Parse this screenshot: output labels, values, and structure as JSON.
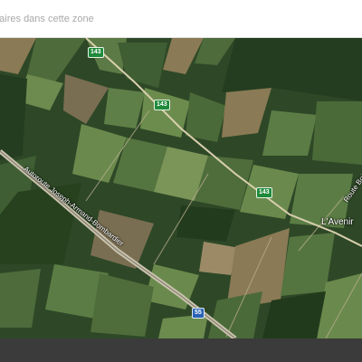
{
  "search": {
    "placeholder": "...aires dans cette zone"
  },
  "map": {
    "type": "satellite",
    "road_shields": [
      "143",
      "143",
      "143",
      "55"
    ],
    "places": [
      "L'Avenir"
    ],
    "roads": [
      "Autoroute Joseph-Armand-Bombardier",
      "Route Boi..."
    ],
    "colors": {
      "forest": "#2f4a28",
      "field": "#5b7d45",
      "road_shield_green": "#1f8a3a",
      "highway_shield_blue": "#2a63b5"
    }
  }
}
